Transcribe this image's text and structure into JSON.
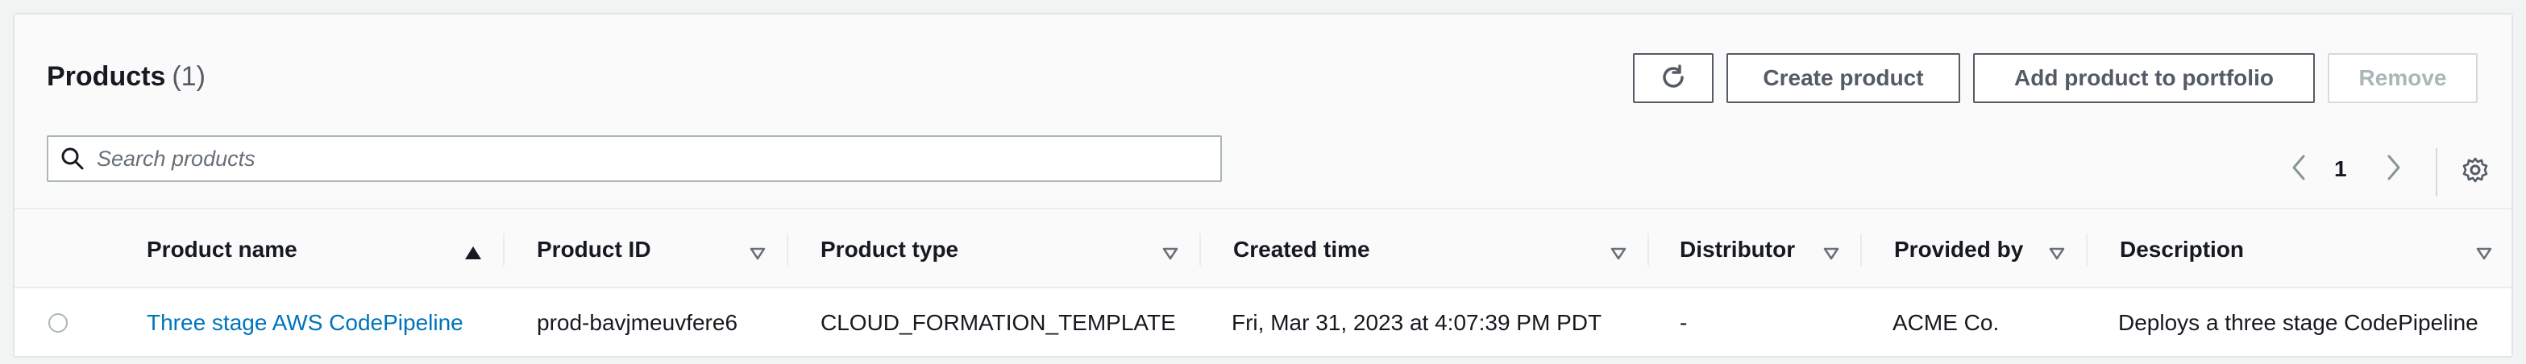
{
  "products": {
    "title": "Products",
    "count": "(1)"
  },
  "toolbar": {
    "refresh_icon": "refresh-icon",
    "create_label": "Create product",
    "add_label": "Add product to portfolio",
    "remove_label": "Remove"
  },
  "search": {
    "placeholder": "Search products",
    "icon": "search-icon"
  },
  "pagination": {
    "current_page": "1",
    "prev_icon": "chevron-left-icon",
    "next_icon": "chevron-right-icon",
    "settings_icon": "gear-icon"
  },
  "table": {
    "columns": [
      {
        "label": "Product name",
        "sort": "ascending"
      },
      {
        "label": "Product ID",
        "sort": "none"
      },
      {
        "label": "Product type",
        "sort": "none"
      },
      {
        "label": "Created time",
        "sort": "none"
      },
      {
        "label": "Distributor",
        "sort": "none"
      },
      {
        "label": "Provided by",
        "sort": "none"
      },
      {
        "label": "Description",
        "sort": "none"
      }
    ],
    "rows": [
      {
        "name": "Three stage AWS CodePipeline",
        "id": "prod-bavjmeuvfere6",
        "type": "CLOUD_FORMATION_TEMPLATE",
        "created": "Fri, Mar 31, 2023 at 4:07:39 PM PDT",
        "distributor": "-",
        "provider": "ACME Co.",
        "description": "Deploys a three stage CodePipeline"
      }
    ]
  },
  "colors": {
    "link": "#0073bb",
    "text": "#16191f",
    "muted": "#545b64",
    "disabled": "#aab7b8"
  }
}
